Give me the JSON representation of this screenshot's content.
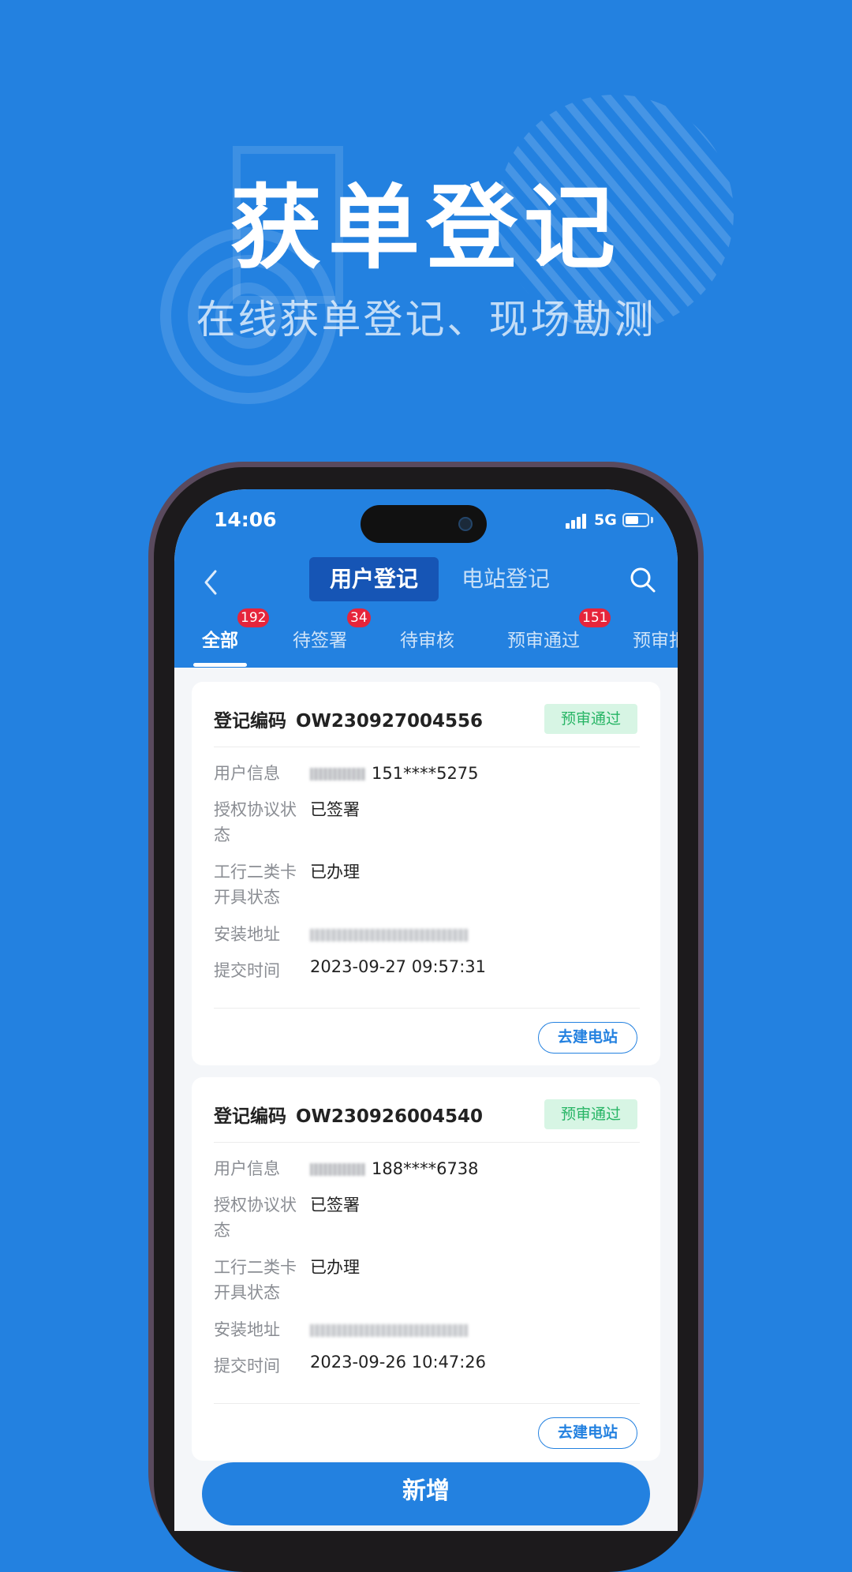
{
  "hero": {
    "title": "获单登记",
    "subtitle": "在线获单登记、现场勘测"
  },
  "status_bar": {
    "time": "14:06",
    "network": "5G"
  },
  "header": {
    "segments": [
      "用户登记",
      "电站登记"
    ],
    "active_segment": "用户登记"
  },
  "tabs": [
    {
      "label": "全部",
      "badge": "192",
      "active": true
    },
    {
      "label": "待签署",
      "badge": "34",
      "active": false
    },
    {
      "label": "待审核",
      "badge": "",
      "active": false
    },
    {
      "label": "预审通过",
      "badge": "151",
      "active": false
    },
    {
      "label": "预审拒",
      "badge": "",
      "active": false
    }
  ],
  "field_labels": {
    "code": "登记编码",
    "user_info": "用户信息",
    "auth_status": "授权协议状态",
    "card_status": "工行二类卡开具状态",
    "address": "安装地址",
    "submit_time": "提交时间"
  },
  "records": [
    {
      "code": "OW230927004556",
      "status": "预审通过",
      "phone": "151****5275",
      "auth_status": "已签署",
      "card_status": "已办理",
      "submit_time": "2023-09-27 09:57:31",
      "action": "去建电站"
    },
    {
      "code": "OW230926004540",
      "status": "预审通过",
      "phone": "188****6738",
      "auth_status": "已签署",
      "card_status": "已办理",
      "submit_time": "2023-09-26 10:47:26",
      "action": "去建电站"
    }
  ],
  "footer": {
    "add_label": "新增"
  },
  "colors": {
    "brand_blue": "#2381e0",
    "segment_active": "#1655b5",
    "badge_red": "#e6253b",
    "status_green": "#27b565",
    "status_green_bg": "#d7f5e4"
  }
}
